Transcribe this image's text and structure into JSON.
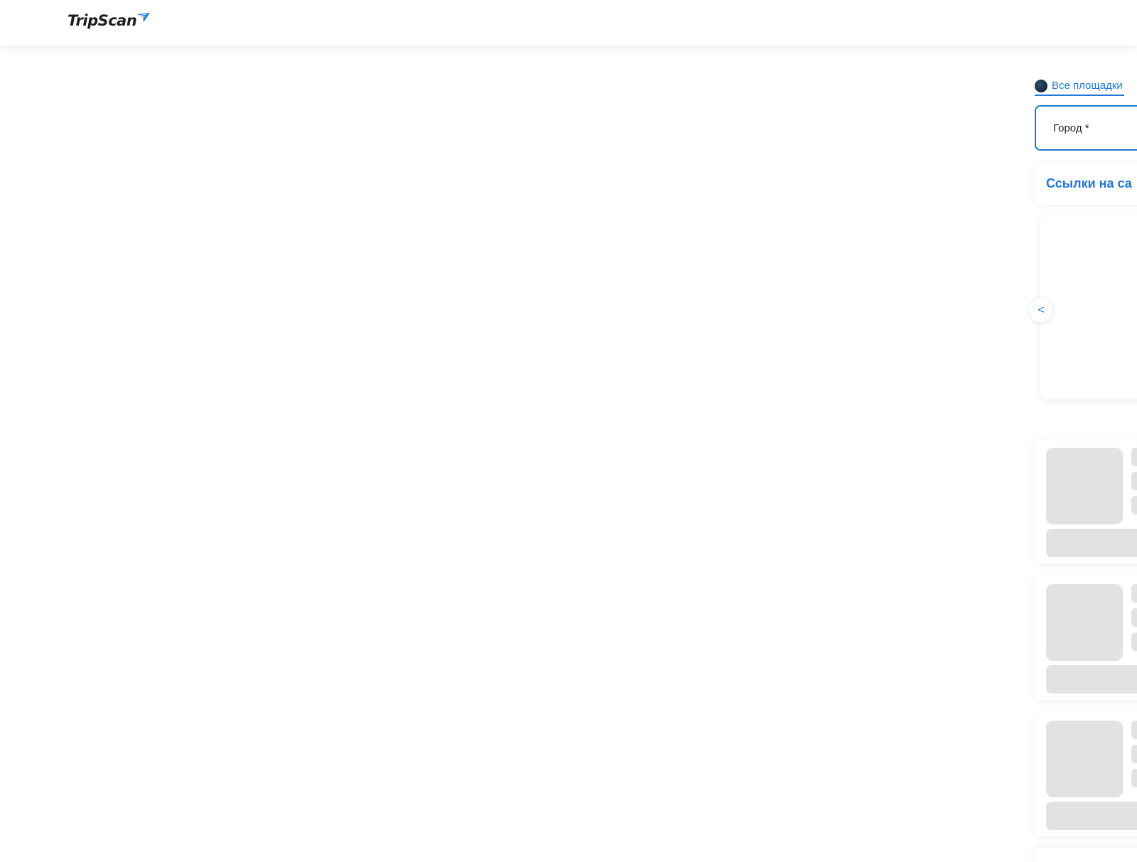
{
  "header": {
    "logo_text": "TripScan",
    "brand_color": "#1f78d1"
  },
  "filters": {
    "platform_link": "Все площадки",
    "platform_icon": "globe-icon",
    "city_label": "Город *"
  },
  "links_section": {
    "title": "Ссылки на са"
  },
  "carousel": {
    "prev_label": "<"
  },
  "skeleton_cards": [
    {
      "state": "loading"
    },
    {
      "state": "loading"
    },
    {
      "state": "loading"
    }
  ]
}
